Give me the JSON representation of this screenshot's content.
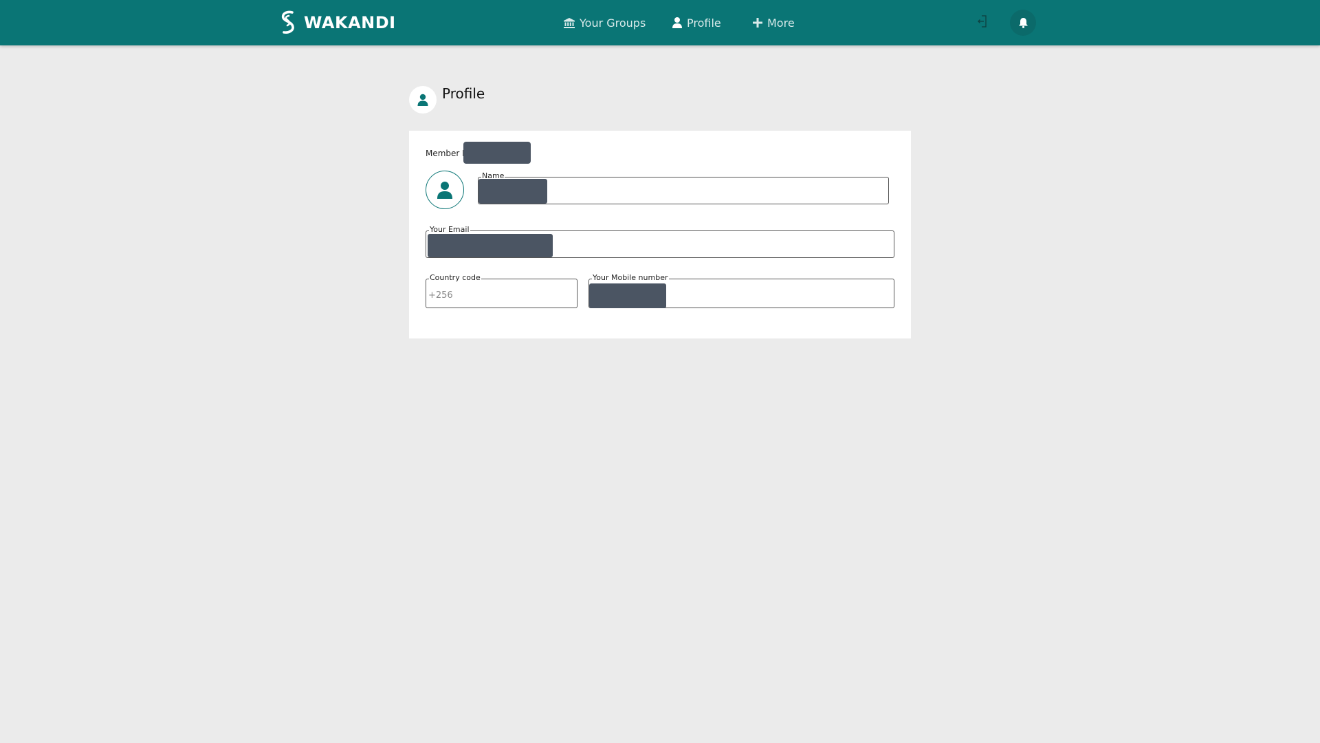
{
  "app": {
    "brand_name": "WAKANDI",
    "brand_color": "#0a7575"
  },
  "nav": {
    "items": [
      {
        "label": "Your Groups",
        "icon": "bank-icon"
      },
      {
        "label": "Profile",
        "icon": "user-icon"
      },
      {
        "label": "More",
        "icon": "plus-icon"
      }
    ],
    "logout_icon": "logout-icon",
    "notifications_icon": "bell-icon"
  },
  "page": {
    "title": "Profile",
    "icon": "user-icon"
  },
  "profile_form": {
    "member_id_label": "Member ID",
    "member_id_value": "",
    "avatar_icon": "user-icon",
    "name_label": "Name",
    "name_value": "",
    "email_label": "Your Email",
    "email_value": "",
    "country_code_label": "Country code",
    "country_code_placeholder": "+256",
    "country_code_value": "",
    "mobile_label": "Your Mobile number",
    "mobile_value": "",
    "redacted_color": "#4b5563"
  }
}
